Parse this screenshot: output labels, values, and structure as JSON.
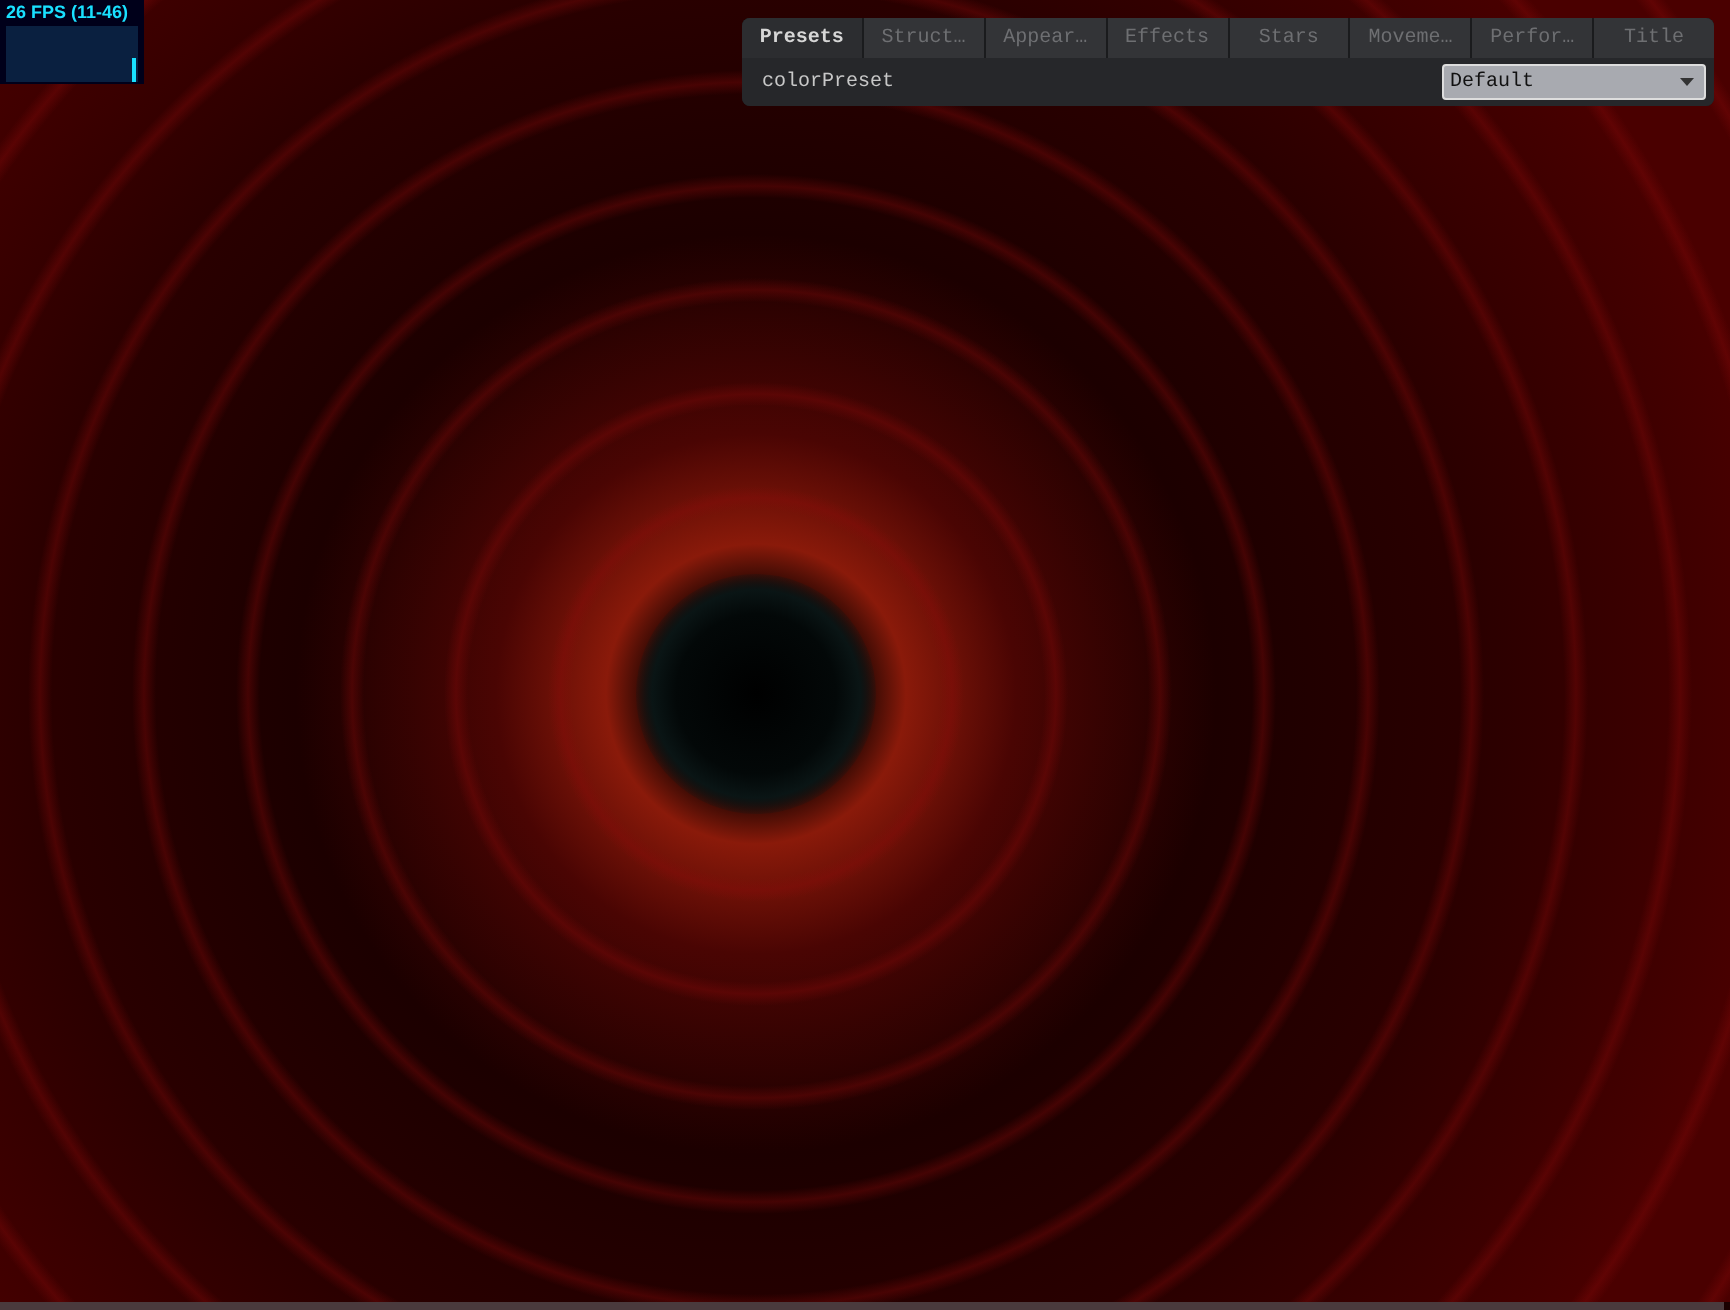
{
  "stats": {
    "fps": "26 FPS (11-46)"
  },
  "panel": {
    "tabs": [
      {
        "label": "Presets",
        "selected": true
      },
      {
        "label": "Struct…",
        "selected": false
      },
      {
        "label": "Appear…",
        "selected": false
      },
      {
        "label": "Effects",
        "selected": false
      },
      {
        "label": "Stars",
        "selected": false
      },
      {
        "label": "Moveme…",
        "selected": false
      },
      {
        "label": "Perfor…",
        "selected": false
      },
      {
        "label": "Title",
        "selected": false
      }
    ],
    "controls": [
      {
        "kind": "dropdown",
        "label": "colorPreset",
        "value": "Default"
      }
    ]
  }
}
